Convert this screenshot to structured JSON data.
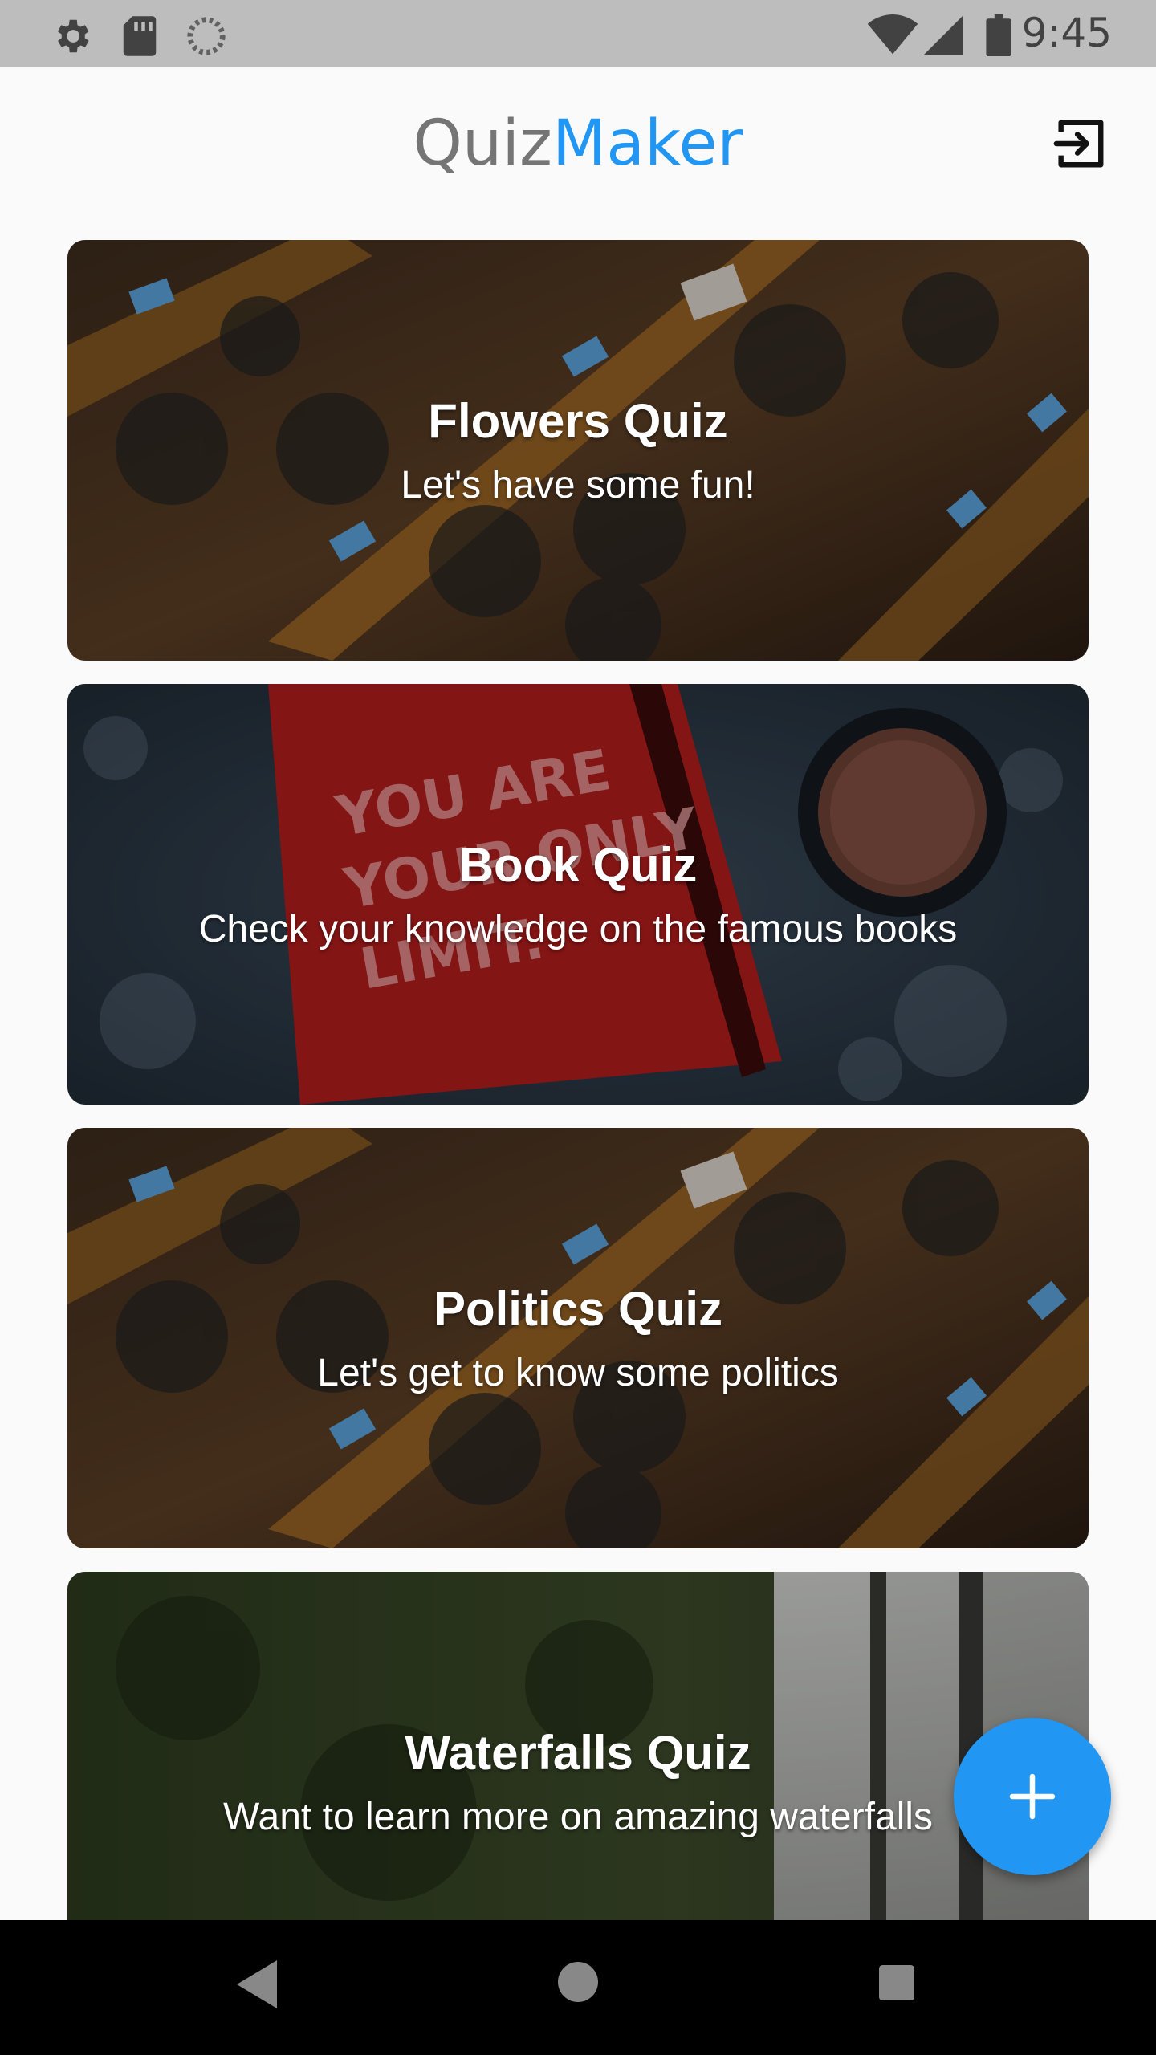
{
  "status_bar": {
    "time": "9:45",
    "left_icons": [
      "settings-icon",
      "sd-card-icon",
      "loading-icon"
    ],
    "right_icons": [
      "wifi-icon",
      "signal-icon",
      "battery-icon"
    ]
  },
  "app_bar": {
    "title_part1": "Quiz",
    "title_part2": "Maker",
    "title_color1": "#757575",
    "title_color2": "#2196f3",
    "logout_icon": "logout-icon"
  },
  "quizzes": [
    {
      "title": "Flowers Quiz",
      "subtitle": "Let's have some fun!",
      "image": "parliament-desks"
    },
    {
      "title": "Book Quiz",
      "subtitle": "Check your knowledge on the famous books",
      "image": "red-book-coffee"
    },
    {
      "title": "Politics Quiz",
      "subtitle": "Let's get to know some politics",
      "image": "parliament-desks"
    },
    {
      "title": "Waterfalls Quiz",
      "subtitle": "Want to learn more on amazing waterfalls",
      "image": "waterfall"
    }
  ],
  "fab": {
    "icon": "add-icon",
    "color": "#2196f3"
  },
  "nav_bar": {
    "buttons": [
      "back-icon",
      "home-icon",
      "recents-icon"
    ]
  }
}
